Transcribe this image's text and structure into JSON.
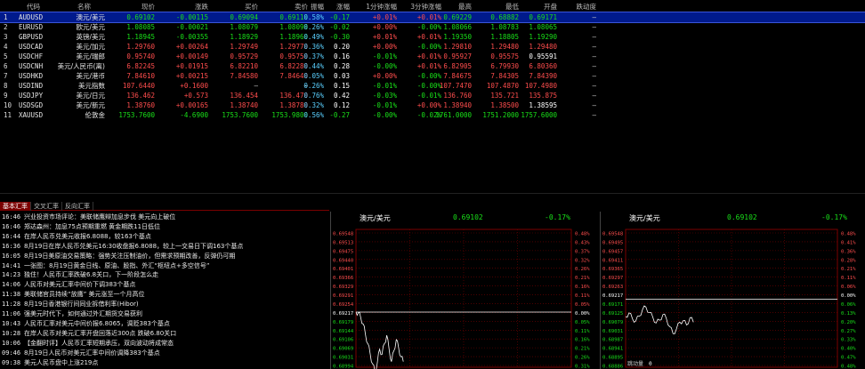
{
  "columns": [
    "代码",
    "名称",
    "现价",
    "涨跌",
    "买价",
    "卖价",
    "振幅",
    "涨幅",
    "1分钟涨幅",
    "3分钟涨幅",
    "最高",
    "最低",
    "开盘",
    "跌动度"
  ],
  "rows": [
    {
      "idx": "1",
      "code": "AUDUSD",
      "name": "澳元/美元",
      "price": "0.69102",
      "chg": "-0.00115",
      "bid": "0.69094",
      "ask": "0.69110",
      "amp": "0.58%",
      "spread": "-0.17",
      "m1": "+0.01%",
      "m3": "+0.01%",
      "high": "0.69229",
      "low": "0.68882",
      "open": "0.69171",
      "vol": "—",
      "dir": "dn"
    },
    {
      "idx": "2",
      "code": "EURUSD",
      "name": "欧元/美元",
      "price": "1.08085",
      "chg": "-0.00021",
      "bid": "1.08079",
      "ask": "1.08098",
      "amp": "0.26%",
      "spread": "-0.02",
      "m1": "+0.00%",
      "m3": "-0.00%",
      "high": "1.08066",
      "low": "1.08783",
      "open": "1.08065",
      "vol": "—",
      "dir": "dn"
    },
    {
      "idx": "3",
      "code": "GBPUSD",
      "name": "英镑/美元",
      "price": "1.18945",
      "chg": "-0.00355",
      "bid": "1.18929",
      "ask": "1.18960",
      "amp": "0.49%",
      "spread": "-0.30",
      "m1": "+0.01%",
      "m3": "+0.01%",
      "high": "1.19350",
      "low": "1.18805",
      "open": "1.19290",
      "vol": "—",
      "dir": "dn"
    },
    {
      "idx": "4",
      "code": "USDCAD",
      "name": "美元/加元",
      "price": "1.29760",
      "chg": "+0.00264",
      "bid": "1.29749",
      "ask": "1.29770",
      "amp": "0.36%",
      "spread": "0.20",
      "m1": "+0.00%",
      "m3": "-0.00%",
      "high": "1.29810",
      "low": "1.29480",
      "open": "1.29480",
      "vol": "—",
      "dir": "up"
    },
    {
      "idx": "5",
      "code": "USDCHF",
      "name": "美元/瑞郎",
      "price": "0.95740",
      "chg": "+0.00149",
      "bid": "0.95729",
      "ask": "0.95750",
      "amp": "0.37%",
      "spread": "0.16",
      "m1": "-0.01%",
      "m3": "+0.01%",
      "high": "0.95927",
      "low": "0.95575",
      "open": "0.95591",
      "vol": "—",
      "dir": "up"
    },
    {
      "idx": "6",
      "code": "USDCNH",
      "name": "美元/人民币(离)",
      "price": "6.82245",
      "chg": "+0.01915",
      "bid": "6.82210",
      "ask": "6.82280",
      "amp": "0.44%",
      "spread": "0.28",
      "m1": "-0.00%",
      "m3": "+0.01%",
      "high": "6.82905",
      "low": "6.79930",
      "open": "6.80360",
      "vol": "—",
      "dir": "up"
    },
    {
      "idx": "7",
      "code": "USDHKD",
      "name": "美元/港币",
      "price": "7.84610",
      "chg": "+0.00215",
      "bid": "7.84580",
      "ask": "7.84640",
      "amp": "0.05%",
      "spread": "0.03",
      "m1": "+0.00%",
      "m3": "-0.00%",
      "high": "7.84675",
      "low": "7.84305",
      "open": "7.84390",
      "vol": "—",
      "dir": "up"
    },
    {
      "idx": "8",
      "code": "USDIND",
      "name": "美元指数",
      "price": "107.6440",
      "chg": "+0.1600",
      "bid": "—",
      "ask": "—",
      "amp": "0.26%",
      "spread": "0.15",
      "m1": "-0.01%",
      "m3": "-0.00%",
      "high": "107.7470",
      "low": "107.4870",
      "open": "107.4980",
      "vol": "—",
      "dir": "up"
    },
    {
      "idx": "9",
      "code": "USDJPY",
      "name": "美元/日元",
      "price": "136.462",
      "chg": "+0.573",
      "bid": "136.454",
      "ask": "136.470",
      "amp": "0.76%",
      "spread": "0.42",
      "m1": "-0.03%",
      "m3": "-0.01%",
      "high": "136.760",
      "low": "135.721",
      "open": "135.875",
      "vol": "—",
      "dir": "up"
    },
    {
      "idx": "10",
      "code": "USDSGD",
      "name": "美元/新元",
      "price": "1.38760",
      "chg": "+0.00165",
      "bid": "1.38740",
      "ask": "1.38780",
      "amp": "0.32%",
      "spread": "0.12",
      "m1": "-0.01%",
      "m3": "+0.00%",
      "high": "1.38940",
      "low": "1.38500",
      "open": "1.38595",
      "vol": "—",
      "dir": "up"
    },
    {
      "idx": "11",
      "code": "XAUUSD",
      "name": "伦敦金",
      "price": "1753.7600",
      "chg": "-4.6900",
      "bid": "1753.7600",
      "ask": "1753.9800",
      "amp": "0.56%",
      "spread": "-0.27",
      "m1": "-0.00%",
      "m3": "-0.02%",
      "high": "1761.0000",
      "low": "1751.2000",
      "open": "1757.6000",
      "vol": "—",
      "dir": "dn"
    }
  ],
  "tabs": [
    "基本汇率",
    "交叉汇率",
    "反向汇率"
  ],
  "news": [
    {
      "time": "16:46",
      "text": "兴业投资市场评论：美联储鹰辩加息步伐 美元向上破位"
    },
    {
      "time": "16:46",
      "text": "郑达森州：加息75点预期重燃 黄金期跌11日低位"
    },
    {
      "time": "16:44",
      "text": "在岸人民币兑美元收报6.8088，较163个基点"
    },
    {
      "time": "16:36",
      "text": "8月19日在岸人民币兑美元16:30收盘报6.8088，较上一交易日下调163个基点"
    },
    {
      "time": "16:05",
      "text": "8月19日美原油交易策略：强势关注压制油价，但需求预期改善，反弹仍可期"
    },
    {
      "time": "14:41",
      "text": "一张图：8月19日黄金日线、原油、股指、外汇“枢纽点+多空信号”"
    },
    {
      "time": "14:23",
      "text": "独住！人民币汇率跌破6.8关口，下一阶段怎么走"
    },
    {
      "time": "14:06",
      "text": "人民币对美元汇率中间价下调383个基点"
    },
    {
      "time": "11:38",
      "text": "美联储官员持续“放鹰” 美元涨至一个月高位"
    },
    {
      "time": "11:28",
      "text": "8月19日香港银行间同业拆借利率(Hibor)"
    },
    {
      "time": "11:06",
      "text": "强美元时代下，如何通过外汇期货交易获利"
    },
    {
      "time": "10:43",
      "text": "人民币汇率对美元中间价报6.8065，调贬383个基点"
    },
    {
      "time": "10:28",
      "text": "在岸人民币对美元汇率开盘回落近300点 跌破6.80关口"
    },
    {
      "time": "10:06",
      "text": "【金翻时评】人民币汇率短期承压，双向波动将成常态"
    },
    {
      "time": "09:46",
      "text": "8月19日人民币对美元汇率中间价调降383个基点"
    },
    {
      "time": "09:38",
      "text": "美元人民币盘中上涨219点"
    }
  ],
  "chart_left": {
    "title": "澳元/美元",
    "price": "0.69102",
    "pct": "-0.17%",
    "left_axis": [
      "0.69548",
      "0.69513",
      "0.69475",
      "0.69440",
      "0.69401",
      "0.69366",
      "0.69329",
      "0.69291",
      "0.69254",
      "0.69217",
      "0.69179",
      "0.69144",
      "0.69106",
      "0.69069",
      "0.69031",
      "0.68994"
    ],
    "right_axis": [
      "0.48%",
      "0.43%",
      "0.37%",
      "0.32%",
      "0.26%",
      "0.21%",
      "0.16%",
      "0.11%",
      "0.05%",
      "0.00%",
      "0.05%",
      "0.11%",
      "0.16%",
      "0.21%",
      "0.26%",
      "0.31%"
    ],
    "ref_label": "0.69217",
    "series": [
      0.69218,
      0.69214,
      0.69195,
      0.69168,
      0.69125,
      0.69085,
      0.69042,
      0.69001,
      0.68965,
      0.69005,
      0.69062,
      0.6904,
      0.69085,
      0.6912,
      0.6906,
      0.6901,
      0.69055,
      0.69102,
      0.69068,
      0.6903,
      0.6901
    ]
  },
  "chart_right": {
    "title": "澳元/美元",
    "price": "0.69102",
    "pct": "-0.17%",
    "left_axis": [
      "0.69548",
      "0.69495",
      "0.69457",
      "0.69411",
      "0.69365",
      "0.69297",
      "0.69263",
      "0.69217",
      "0.69171",
      "0.69125",
      "0.69079",
      "0.69031",
      "0.68987",
      "0.68941",
      "0.68895",
      "0.68886"
    ],
    "right_axis": [
      "0.48%",
      "0.41%",
      "0.36%",
      "0.28%",
      "0.21%",
      "0.11%",
      "0.06%",
      "0.00%",
      "0.06%",
      "0.13%",
      "0.20%",
      "0.27%",
      "0.33%",
      "0.40%",
      "0.47%",
      "0.48%"
    ],
    "ref_label": "0.69217",
    "volume_label": "跳动量",
    "volume_value": "0",
    "series": [
      0.6913,
      0.69148,
      0.6912,
      0.69108,
      0.69132,
      0.69165,
      0.69178,
      0.6915,
      0.69128,
      0.69098,
      0.69112,
      0.6914,
      0.69122,
      0.6908,
      0.69045,
      0.69068,
      0.69102,
      0.6911,
      0.69088,
      0.69125,
      0.69102
    ]
  }
}
